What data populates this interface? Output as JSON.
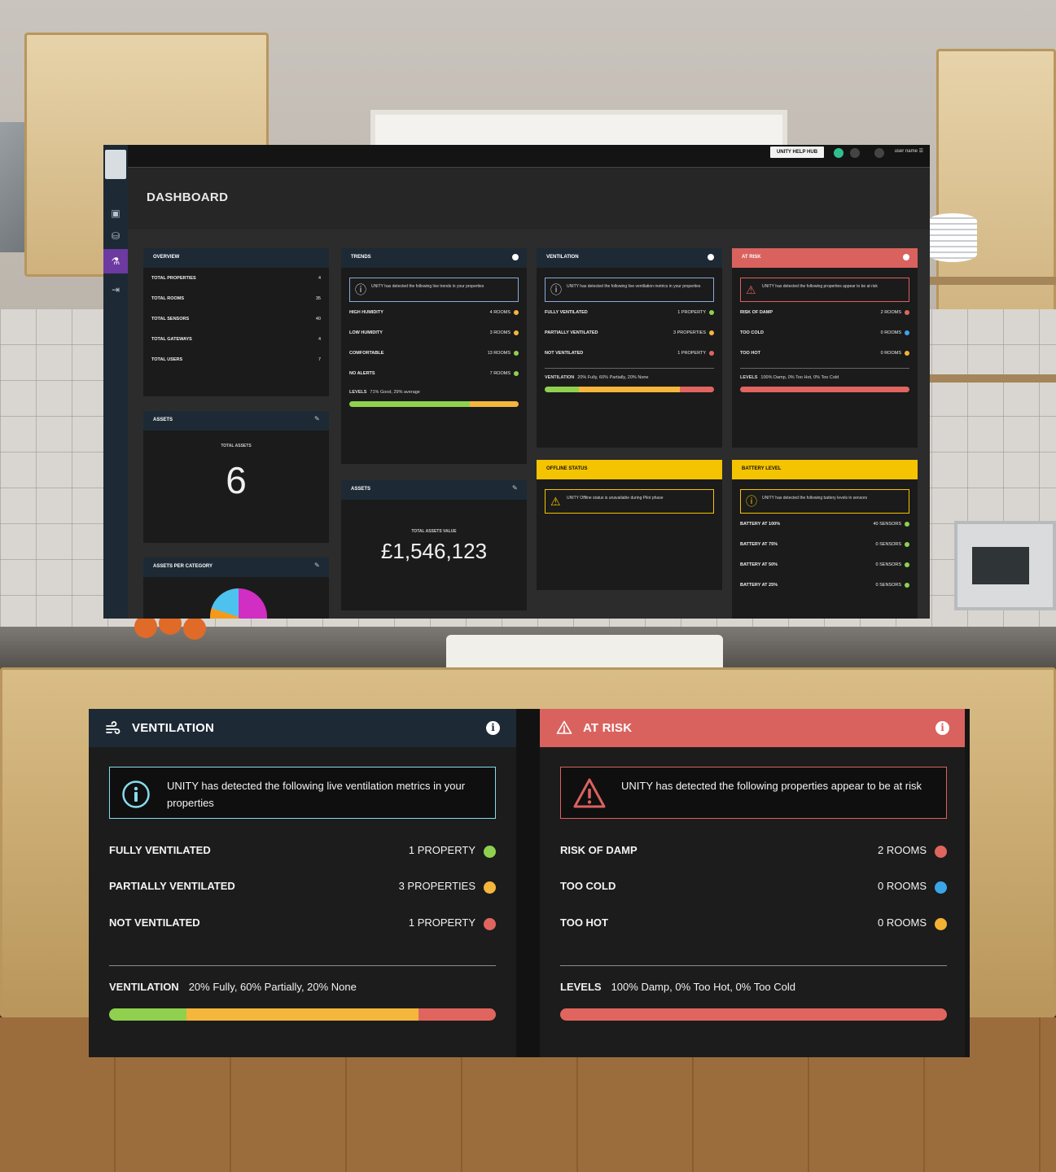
{
  "colors": {
    "navy": "#1d2a35",
    "red": "#d9625f",
    "yellow": "#f5c400",
    "green": "#8fd14f",
    "amber": "#f4b63b",
    "pink": "#e0655f",
    "blue": "#3aa6e8",
    "orange": "#f2b233"
  },
  "dashboard": {
    "title": "DASHBOARD",
    "help_button": "UNITY HELP HUB",
    "user_name": "user name",
    "overview": {
      "title": "OVERVIEW",
      "rows": [
        {
          "label": "TOTAL PROPERTIES",
          "value": "4"
        },
        {
          "label": "TOTAL ROOMS",
          "value": "35"
        },
        {
          "label": "TOTAL SENSORS",
          "value": "40"
        },
        {
          "label": "TOTAL GATEWAYS",
          "value": "4"
        },
        {
          "label": "TOTAL USERS",
          "value": "7"
        }
      ]
    },
    "trends": {
      "title": "TRENDS",
      "note": "UNITY has detected the following live trends in your properties",
      "rows": [
        {
          "label": "HIGH HUMIDITY",
          "value": "4 ROOMS",
          "color": "#f4b63b"
        },
        {
          "label": "LOW HUMIDITY",
          "value": "3 ROOMS",
          "color": "#f4b63b"
        },
        {
          "label": "COMFORTABLE",
          "value": "13 ROOMS",
          "color": "#8fd14f"
        },
        {
          "label": "NO ALERTS",
          "value": "7 ROOMS",
          "color": "#8fd14f"
        }
      ],
      "levels_label": "LEVELS",
      "levels_text": "71% Good, 29% average"
    },
    "ventilation_mini": {
      "title": "VENTILATION",
      "note": "UNITY has detected the following live ventilation metrics in your properties",
      "rows": [
        {
          "label": "FULLY VENTILATED",
          "value": "1 PROPERTY",
          "color": "#8fd14f"
        },
        {
          "label": "PARTIALLY VENTILATED",
          "value": "3 PROPERTIES",
          "color": "#f4b63b"
        },
        {
          "label": "NOT VENTILATED",
          "value": "1 PROPERTY",
          "color": "#e0655f"
        }
      ],
      "levels_label": "VENTILATION",
      "levels_text": "20% Fully, 60% Partially, 20% None"
    },
    "at_risk_mini": {
      "title": "AT RISK",
      "note": "UNITY has detected the following properties appear to be at risk",
      "rows": [
        {
          "label": "RISK OF DAMP",
          "value": "2 ROOMS",
          "color": "#e0655f"
        },
        {
          "label": "TOO COLD",
          "value": "0 ROOMS",
          "color": "#3aa6e8"
        },
        {
          "label": "TOO HOT",
          "value": "0 ROOMS",
          "color": "#f2b233"
        }
      ],
      "levels_label": "LEVELS",
      "levels_text": "100% Damp, 0% Too Hot, 0% Too Cold"
    },
    "assets": {
      "title": "ASSETS",
      "total_label": "TOTAL ASSETS",
      "total_value": "6"
    },
    "assets_value": {
      "title": "ASSETS",
      "total_label": "TOTAL ASSETS VALUE",
      "total_value": "£1,546,123"
    },
    "assets_per_category": {
      "title": "ASSETS PER CATEGORY"
    },
    "offline_status": {
      "title": "OFFLINE STATUS",
      "note": "UNITY Offline status is unavailable during Pilot phase"
    },
    "battery_level": {
      "title": "BATTERY LEVEL",
      "note": "UNITY has detected the following battery levels in sensors",
      "rows": [
        {
          "label": "BATTERY AT 100%",
          "value": "40 SENSORS",
          "color": "#8fd14f"
        },
        {
          "label": "BATTERY AT 75%",
          "value": "0 SENSORS",
          "color": "#8fd14f"
        },
        {
          "label": "BATTERY AT 50%",
          "value": "0 SENSORS",
          "color": "#8fd14f"
        },
        {
          "label": "BATTERY AT 25%",
          "value": "0 SENSORS",
          "color": "#8fd14f"
        }
      ]
    }
  },
  "ventilation_card": {
    "title": "VENTILATION",
    "icon": "wind-icon",
    "note": "UNITY has detected the following live ventilation metrics in your properties",
    "rows": [
      {
        "label": "FULLY VENTILATED",
        "value": "1 PROPERTY",
        "color": "#8fd14f"
      },
      {
        "label": "PARTIALLY VENTILATED",
        "value": "3 PROPERTIES",
        "color": "#f4b63b"
      },
      {
        "label": "NOT VENTILATED",
        "value": "1 PROPERTY",
        "color": "#e0655f"
      }
    ],
    "levels_label": "VENTILATION",
    "levels_text": "20% Fully, 60% Partially, 20% None",
    "segments": [
      {
        "percent": 20,
        "color": "#8fd14f"
      },
      {
        "percent": 60,
        "color": "#f4b63b"
      },
      {
        "percent": 20,
        "color": "#e0655f"
      }
    ]
  },
  "at_risk_card": {
    "title": "AT RISK",
    "icon": "warning-icon",
    "note": "UNITY has detected the following properties appear to be at risk",
    "rows": [
      {
        "label": "RISK OF DAMP",
        "value": "2 ROOMS",
        "color": "#e0655f"
      },
      {
        "label": "TOO COLD",
        "value": "0 ROOMS",
        "color": "#3aa6e8"
      },
      {
        "label": "TOO HOT",
        "value": "0 ROOMS",
        "color": "#f2b233"
      }
    ],
    "levels_label": "LEVELS",
    "levels_text": "100% Damp, 0% Too Hot, 0% Too Cold",
    "segments": [
      {
        "percent": 100,
        "color": "#e0655f"
      }
    ]
  }
}
